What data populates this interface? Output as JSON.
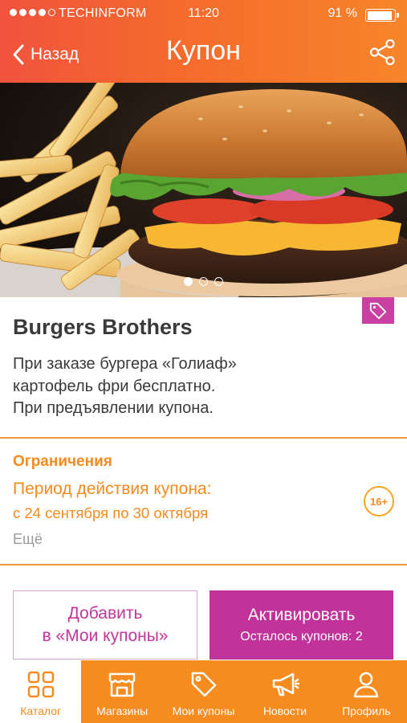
{
  "status_bar": {
    "carrier": "TECHINFORM",
    "time": "11:20",
    "battery": "91 %"
  },
  "nav": {
    "back_label": "Назад",
    "title": "Купон"
  },
  "gallery": {
    "slides": 3,
    "current": 1
  },
  "coupon": {
    "shop_name": "Burgers Brothers",
    "description_lines": [
      "При заказе бургера «Голиаф»",
      "картофель фри бесплатно.",
      "При предъявлении купона."
    ]
  },
  "restrictions": {
    "title": "Ограничения",
    "period_label": "Период действия купона:",
    "period_value": "с 24 сентября по 30 октября",
    "more": "Ещё",
    "age": "16+"
  },
  "actions": {
    "add_line1": "Добавить",
    "add_line2": "в «Мои купоны»",
    "activate": "Активировать",
    "remaining": "Осталось купонов: 2"
  },
  "tabs": [
    {
      "label": "Каталог",
      "icon": "grid-icon",
      "active": true
    },
    {
      "label": "Магазины",
      "icon": "store-icon",
      "active": false
    },
    {
      "label": "Мои купоны",
      "icon": "tag-icon",
      "active": false
    },
    {
      "label": "Новости",
      "icon": "megaphone-icon",
      "active": false
    },
    {
      "label": "Профиль",
      "icon": "person-icon",
      "active": false
    }
  ],
  "colors": {
    "header_start": "#f0533d",
    "header_end": "#f7852a",
    "accent_orange": "#f58b1e",
    "accent_purple": "#c1329a",
    "tabbar": "#f68b1f"
  }
}
